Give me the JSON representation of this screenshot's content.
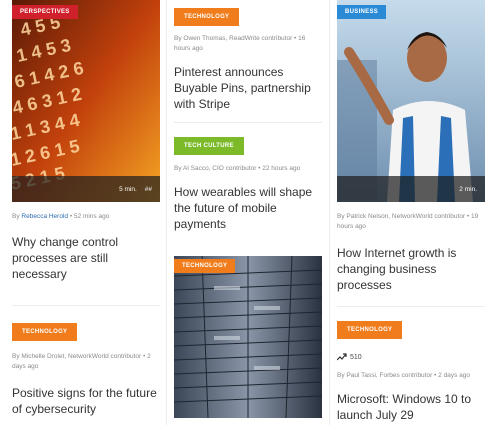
{
  "colors": {
    "perspectives": "#d0202c",
    "technology": "#f07c1c",
    "business": "#2b8ad6",
    "tech_culture": "#7cba2a"
  },
  "col1": {
    "card1": {
      "category": "PERSPECTIVES",
      "read_time": "5 min.",
      "share_glyph": "##",
      "byline_prefix": "By",
      "author": "Rebecca Herold",
      "time": "• 52 mins ago",
      "title": "Why change control processes are still necessary"
    },
    "card2": {
      "category": "TECHNOLOGY",
      "byline": "By Michelle Drolet, NetworkWorld contributor • 2 days ago",
      "title": "Positive signs for the future of cybersecurity"
    }
  },
  "col2": {
    "card1": {
      "category": "TECHNOLOGY",
      "byline": "By Owen Thomas, ReadWrite contributor • 16 hours ago",
      "title": "Pinterest announces Buyable Pins, partnership with Stripe"
    },
    "card2": {
      "category": "TECH CULTURE",
      "byline": "By Al Sacco, CIO contributor • 22 hours ago",
      "title": "How wearables will shape the future of mobile payments"
    },
    "card3": {
      "category": "TECHNOLOGY"
    }
  },
  "col3": {
    "card1": {
      "category": "BUSINESS",
      "read_time": "2 min.",
      "byline": "By Patrick Nelson, NetworkWorld contributor • 19 hours ago",
      "title": "How Internet growth is changing business processes"
    },
    "card2": {
      "category": "TECHNOLOGY",
      "trend_count": "510",
      "byline": "By Paul Tassi, Forbes contributor • 2 days ago",
      "title": "Microsoft: Windows 10 to launch July 29"
    }
  }
}
